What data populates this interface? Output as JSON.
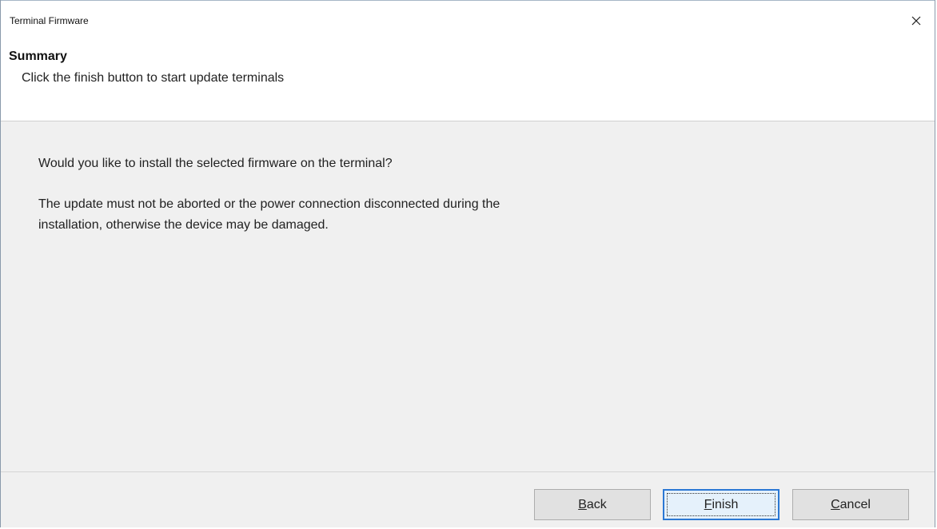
{
  "window": {
    "title": "Terminal Firmware",
    "close_glyph": "✕"
  },
  "header": {
    "title": "Summary",
    "subtitle": "Click the finish button to start update terminals"
  },
  "content": {
    "question": "Would you like to install the selected firmware on the terminal?",
    "warning_line1": "The update must not be aborted or the power connection disconnected during the",
    "warning_line2": "installation, otherwise the device may be damaged."
  },
  "buttons": {
    "back": {
      "accel": "B",
      "rest": "ack"
    },
    "finish": {
      "accel": "F",
      "rest": "inish"
    },
    "cancel": {
      "accel": "C",
      "rest": "ancel"
    }
  },
  "icons": {
    "close": "close-icon"
  },
  "colors": {
    "focus_border": "#2b78d4",
    "content_bg": "#f0f0f0",
    "header_bg": "#ffffff"
  }
}
